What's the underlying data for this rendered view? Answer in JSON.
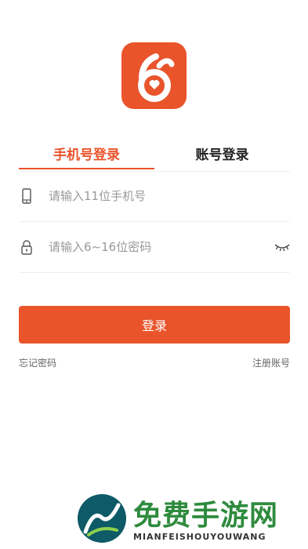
{
  "app": {
    "logo_icon": "app-logo",
    "accent_color": "#e9542b"
  },
  "tabs": [
    {
      "label": "手机号登录",
      "active": true
    },
    {
      "label": "账号登录",
      "active": false
    }
  ],
  "phone_field": {
    "icon": "phone-icon",
    "placeholder": "请输入11位手机号",
    "value": ""
  },
  "password_field": {
    "icon": "lock-icon",
    "placeholder": "请输入6~16位密码",
    "value": "",
    "toggle_icon": "eye-closed-icon"
  },
  "login_button": {
    "label": "登录"
  },
  "links": {
    "forgot_password": "忘记密码",
    "register": "注册账号"
  },
  "watermark": {
    "title": "免费手游网",
    "subtitle": "MIANFEISHOUYOUWANG"
  }
}
